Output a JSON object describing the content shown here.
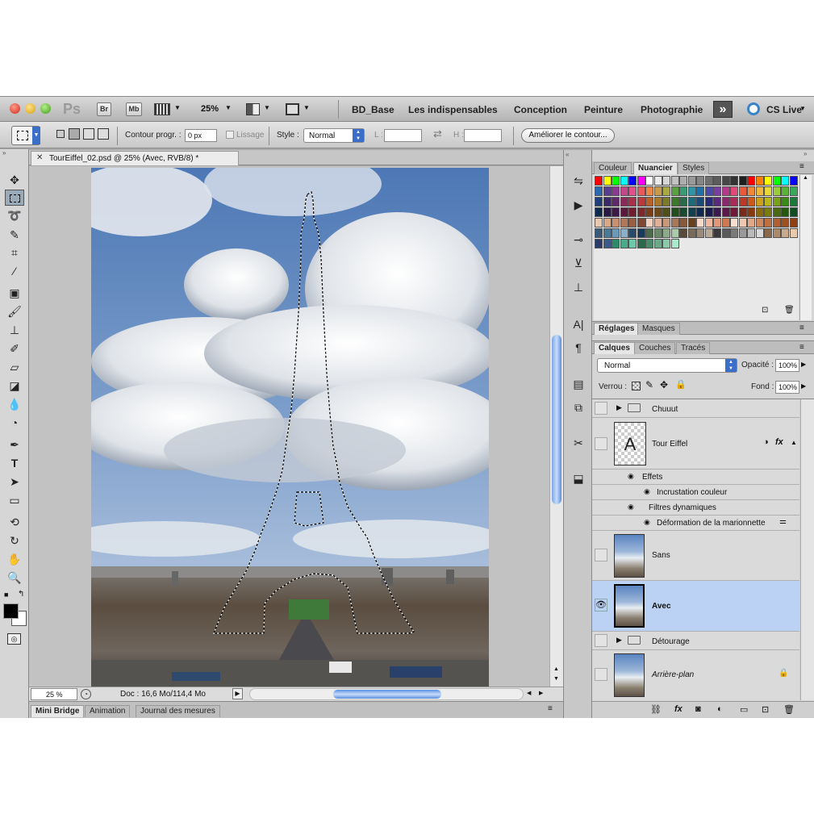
{
  "menubar": {
    "app_logo": "Ps",
    "br_button": "Br",
    "mb_button": "Mb",
    "zoom": "25%",
    "workspaces": [
      "BD_Base",
      "Les indispensables",
      "Conception",
      "Peinture",
      "Photographie"
    ],
    "more": "»",
    "cs_live": "CS Live"
  },
  "options": {
    "contour_label": "Contour progr. :",
    "contour_value": "0 px",
    "lissage_label": "Lissage",
    "style_label": "Style :",
    "style_value": "Normal",
    "l_label": "L :",
    "h_label": "H :",
    "refine_button": "Améliorer le contour..."
  },
  "document": {
    "tab_title": "TourEiffel_02.psd @ 25% (Avec, RVB/8) *",
    "zoom_field": "25 %",
    "doc_info": "Doc : 16,6 Mo/114,4 Mo"
  },
  "bottom_tabs": [
    "Mini Bridge",
    "Animation",
    "Journal des mesures"
  ],
  "color_panel": {
    "tabs": [
      "Couleur",
      "Nuancier",
      "Styles"
    ],
    "active_tab": "Nuancier",
    "swatch_rows": [
      [
        "#ff0000",
        "#ffff00",
        "#00ff00",
        "#00ffff",
        "#0000ff",
        "#ff00ff",
        "#ffffff",
        "#ebebeb",
        "#d6d6d6",
        "#c2c2c2",
        "#adadad",
        "#999999",
        "#858585",
        "#707070",
        "#5c5c5c",
        "#474747",
        "#333333",
        "#1f1f1f",
        "#ff0000",
        "#ff8000",
        "#ffff00",
        "#00ff00",
        "#00ffff",
        "#0000ff"
      ],
      [
        "#2a68b0",
        "#5a3d91",
        "#8a3b8f",
        "#c2468a",
        "#e0508a",
        "#e85a5a",
        "#e8894a",
        "#c89a4e",
        "#a9a941",
        "#5aa143",
        "#3a9a76",
        "#2f95a6",
        "#1f6fa8",
        "#4a4aa8",
        "#7a3da0",
        "#b23a8a",
        "#e04a78",
        "#ea5a3a",
        "#f0883a",
        "#f0b83a",
        "#e8d83a",
        "#9acb3a",
        "#5ab23a",
        "#3aa85a"
      ],
      [
        "#1f3f7a",
        "#3a2a6a",
        "#5e2a6a",
        "#8a2a5a",
        "#a8304a",
        "#b83a3a",
        "#b8602a",
        "#a8782a",
        "#7a7a2a",
        "#3a7a2a",
        "#2a6a4a",
        "#1f6a7a",
        "#1a4a7a",
        "#2a2a7a",
        "#5a2a7a",
        "#8a2a6a",
        "#aa2a5a",
        "#ba3a2a",
        "#ca5a1a",
        "#caa01a",
        "#b8b81a",
        "#7aa01a",
        "#3a8a1a",
        "#1a7a3a"
      ],
      [
        "#0f2a4f",
        "#2a1a4a",
        "#3e1a4a",
        "#5a1a3e",
        "#701f30",
        "#7a2a2a",
        "#7a3f1a",
        "#6a4a1a",
        "#4f4f1a",
        "#234f1a",
        "#1a4a30",
        "#143f4f",
        "#102a4f",
        "#1a1a4f",
        "#3a1a4f",
        "#5a1a4a",
        "#701a3a",
        "#7a2a1a",
        "#8a3a0f",
        "#8a6a0f",
        "#7a7a0f",
        "#4a6a0f",
        "#235a0f",
        "#0f4f23"
      ],
      [
        "#e8c8b0",
        "#d8a888",
        "#c89070",
        "#b07858",
        "#986040",
        "#804830",
        "#f0d0c0",
        "#e0b098",
        "#c89878",
        "#a87858",
        "#885838",
        "#684020",
        "#f8d8c8",
        "#f0b8a0",
        "#e09878",
        "#d07850",
        "#f8e0d0",
        "#f0c8b0",
        "#e0a888",
        "#d08860",
        "#c07040",
        "#b06030",
        "#a05020",
        "#904010"
      ],
      [
        "#3a5a7a",
        "#4a7a9a",
        "#6a9aba",
        "#8ab0c8",
        "#2a4a6a",
        "#1a3a5a",
        "#4a6a4a",
        "#6a8a6a",
        "#8aaa8a",
        "#aacaaa",
        "#5a4a3a",
        "#7a6a5a",
        "#9a8a7a",
        "#baaa9a",
        "#3a3a3a",
        "#5a5a5a",
        "#7a7a7a",
        "#9a9a9a",
        "#bababa",
        "#dadada",
        "#8a6a4a",
        "#aa8a6a",
        "#caaa8a",
        "#eacaaa"
      ],
      [
        "#2a3a6a",
        "#3a5a8a",
        "#2a8a6a",
        "#4aaa8a",
        "#6acaaa",
        "#2a6a4a",
        "#4a8a6a",
        "#6aaa8a",
        "#8acaaa",
        "#aaeaca"
      ]
    ]
  },
  "adjust_panel": {
    "tabs": [
      "Réglages",
      "Masques"
    ]
  },
  "layers_panel": {
    "tabs": [
      "Calques",
      "Couches",
      "Tracés"
    ],
    "blend_mode": "Normal",
    "opacity_label": "Opacité :",
    "opacity_value": "100%",
    "lock_label": "Verrou :",
    "fill_label": "Fond :",
    "fill_value": "100%",
    "layers": [
      {
        "name": "Chuuut",
        "kind": "group"
      },
      {
        "name": "Tour Eiffel",
        "kind": "smart"
      },
      {
        "name": "Effets",
        "kind": "fx"
      },
      {
        "name": "Incrustation couleur",
        "kind": "fx-item"
      },
      {
        "name": "Filtres dynamiques",
        "kind": "fx"
      },
      {
        "name": "Déformation de la marionnette",
        "kind": "fx-item"
      },
      {
        "name": "Sans",
        "kind": "pixel"
      },
      {
        "name": "Avec",
        "kind": "pixel",
        "selected": true,
        "visible": true
      },
      {
        "name": "Détourage",
        "kind": "group"
      },
      {
        "name": "Arrière-plan",
        "kind": "background"
      }
    ]
  },
  "colors": {
    "accent": "#bcd2f5",
    "selection_blue": "#3b7be0"
  }
}
